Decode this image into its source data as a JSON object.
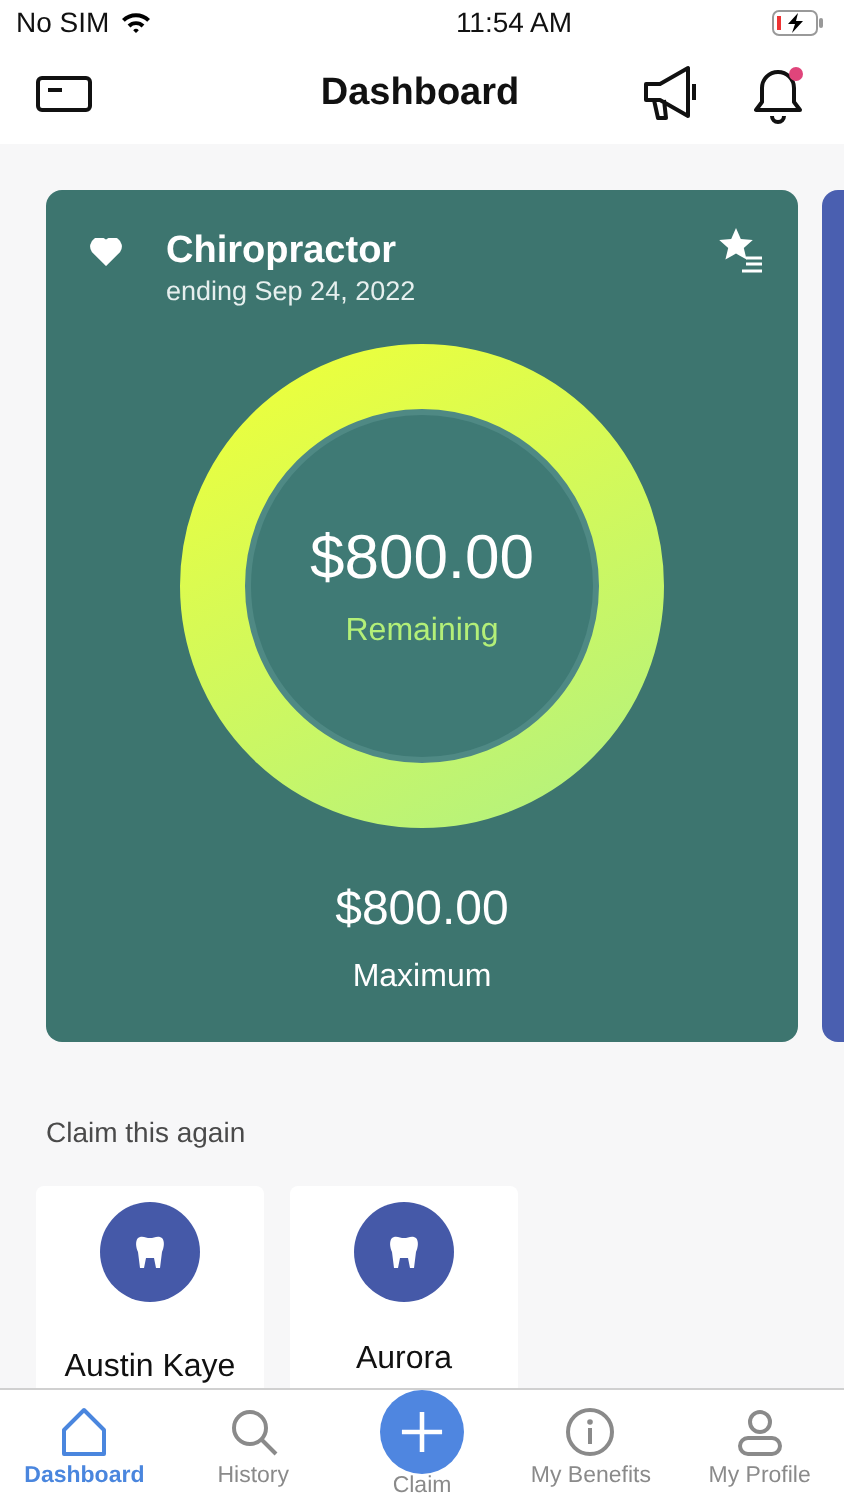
{
  "status_bar": {
    "carrier": "No SIM",
    "time": "11:54 AM",
    "charging": true
  },
  "header": {
    "title": "Dashboard",
    "unread_notifications": true
  },
  "benefit_card": {
    "title": "Chiropractor",
    "subtitle": "ending Sep 24, 2022",
    "favorite": true,
    "remaining": "$800.00",
    "remaining_label": "Remaining",
    "maximum": "$800.00",
    "maximum_label": "Maximum"
  },
  "claim_again": {
    "heading": "Claim this again",
    "cards": [
      {
        "name": "Austin Kaye"
      },
      {
        "name": "Aurora"
      }
    ]
  },
  "tab_bar": [
    {
      "label": "Dashboard",
      "selected": true
    },
    {
      "label": "History",
      "selected": false
    },
    {
      "label": "Claim",
      "selected": false
    },
    {
      "label": "My Benefits",
      "selected": false
    },
    {
      "label": "My Profile",
      "selected": false
    }
  ]
}
